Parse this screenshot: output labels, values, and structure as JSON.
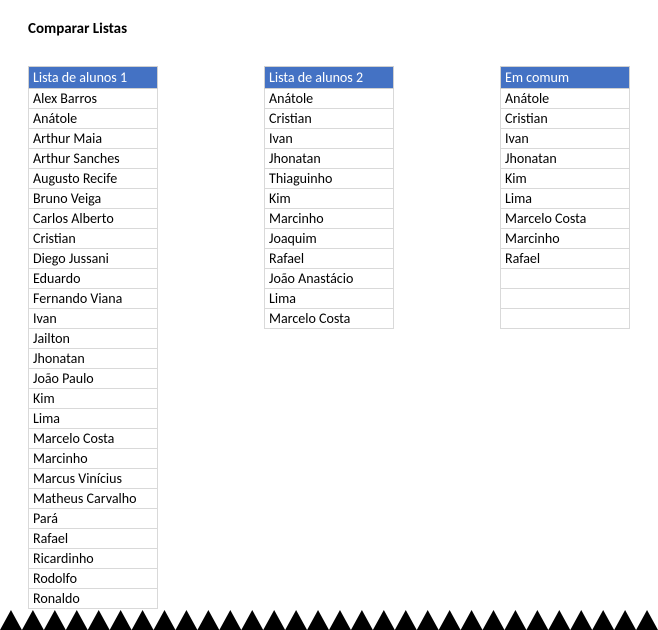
{
  "title": "Comparar Listas",
  "columns": [
    {
      "header": "Lista de alunos 1",
      "rows": [
        "Alex Barros",
        "Anátole",
        "Arthur Maia",
        "Arthur Sanches",
        "Augusto Recife",
        "Bruno Veiga",
        "Carlos Alberto",
        "Cristian",
        "Diego Jussani",
        "Eduardo",
        "Fernando Viana",
        "Ivan",
        "Jailton",
        "Jhonatan",
        "João Paulo",
        "Kim",
        "Lima",
        "Marcelo Costa",
        "Marcinho",
        "Marcus Vinícius",
        "Matheus Carvalho",
        "Pará",
        "Rafael",
        "Ricardinho",
        "Rodolfo",
        "Ronaldo"
      ],
      "empty_rows": 0
    },
    {
      "header": "Lista de alunos 2",
      "rows": [
        "Anátole",
        "Cristian",
        "Ivan",
        "Jhonatan",
        "Thiaguinho",
        "Kim",
        "Marcinho",
        "Joaquim",
        "Rafael",
        "João Anastácio",
        "Lima",
        "Marcelo Costa"
      ],
      "empty_rows": 0
    },
    {
      "header": "Em comum",
      "rows": [
        "Anátole",
        "Cristian",
        "Ivan",
        "Jhonatan",
        "Kim",
        "Lima",
        "Marcelo Costa",
        "Marcinho",
        "Rafael"
      ],
      "empty_rows": 3
    }
  ]
}
